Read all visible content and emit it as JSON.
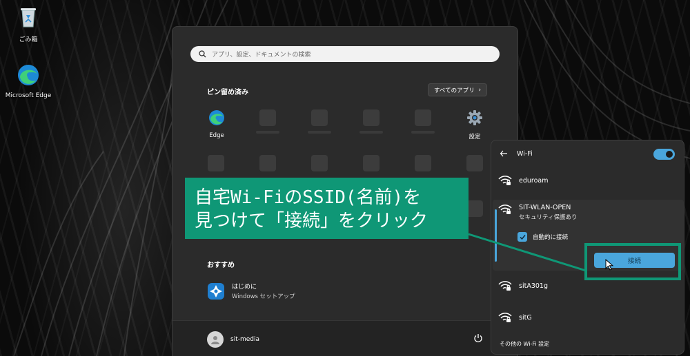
{
  "desktop": {
    "icons": [
      {
        "label": "ごみ箱",
        "icon": "recycle-bin-icon"
      },
      {
        "label": "Microsoft Edge",
        "icon": "edge-icon"
      }
    ]
  },
  "start_menu": {
    "search_placeholder": "アプリ、設定、ドキュメントの検索",
    "pinned_title": "ピン留め済み",
    "all_apps_label": "すべてのアプリ",
    "pinned_apps": [
      {
        "label": "Edge",
        "icon": "edge-icon"
      },
      {
        "label": "設定",
        "icon": "gear-icon"
      }
    ],
    "recommended_title": "おすすめ",
    "recommended_items": [
      {
        "title": "はじめに",
        "subtitle": "Windows セットアップ",
        "icon": "get-started-icon"
      }
    ],
    "user_name": "sit-media"
  },
  "wifi_panel": {
    "title": "Wi-Fi",
    "toggle_on": true,
    "accent_color": "#4aa6dc",
    "networks": [
      {
        "ssid": "eduroam"
      },
      {
        "ssid": "SIT-WLAN-OPEN",
        "status": "セキュリティ保護あり",
        "auto_connect_label": "自動的に接続",
        "auto_connect": true,
        "connect_label": "接続"
      },
      {
        "ssid": "sitA301g"
      },
      {
        "ssid": "sitG"
      }
    ],
    "footer_link": "その他の Wi-Fi 設定"
  },
  "annotation": {
    "text": "自宅Wi-FiのSSID(名前)を\n見つけて「接続」をクリック",
    "color": "#0f9776"
  }
}
